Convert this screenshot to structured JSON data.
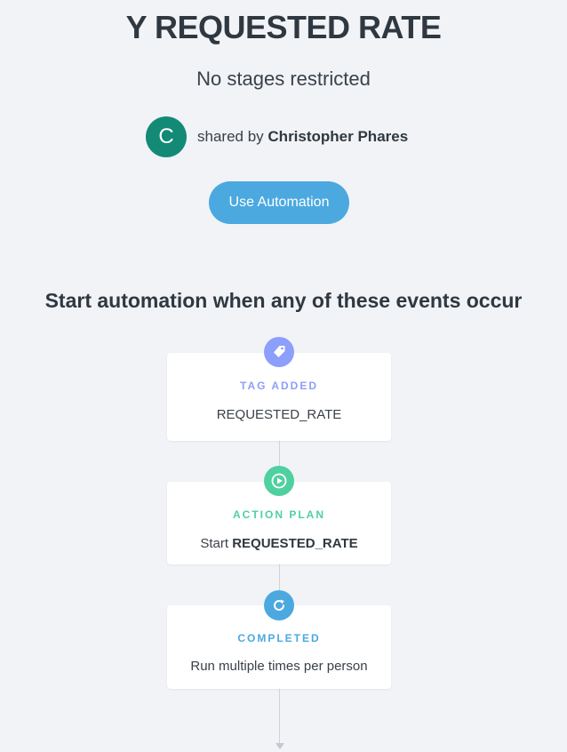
{
  "page": {
    "title": "Y REQUESTED RATE",
    "subtitle": "No stages restricted"
  },
  "share": {
    "avatar_letter": "C",
    "shared_by_label": "shared by",
    "author": "Christopher Phares",
    "avatar_color": "#138a75"
  },
  "actions": {
    "use_automation_label": "Use Automation",
    "button_color": "#4ba9e0"
  },
  "triggers": {
    "heading": "Start automation when any of these events occur",
    "steps": [
      {
        "icon": "tag-icon",
        "kicker": "TAG ADDED",
        "value_prefix": "",
        "value": "REQUESTED_RATE",
        "color": "#8c9ffb"
      },
      {
        "icon": "play-icon",
        "kicker": "ACTION PLAN",
        "value_prefix": "Start",
        "value": "REQUESTED_RATE",
        "color": "#4fd0a0"
      },
      {
        "icon": "refresh-icon",
        "kicker": "COMPLETED",
        "value_prefix": "",
        "value": "Run multiple times per person",
        "color": "#4ba9e0"
      }
    ]
  }
}
